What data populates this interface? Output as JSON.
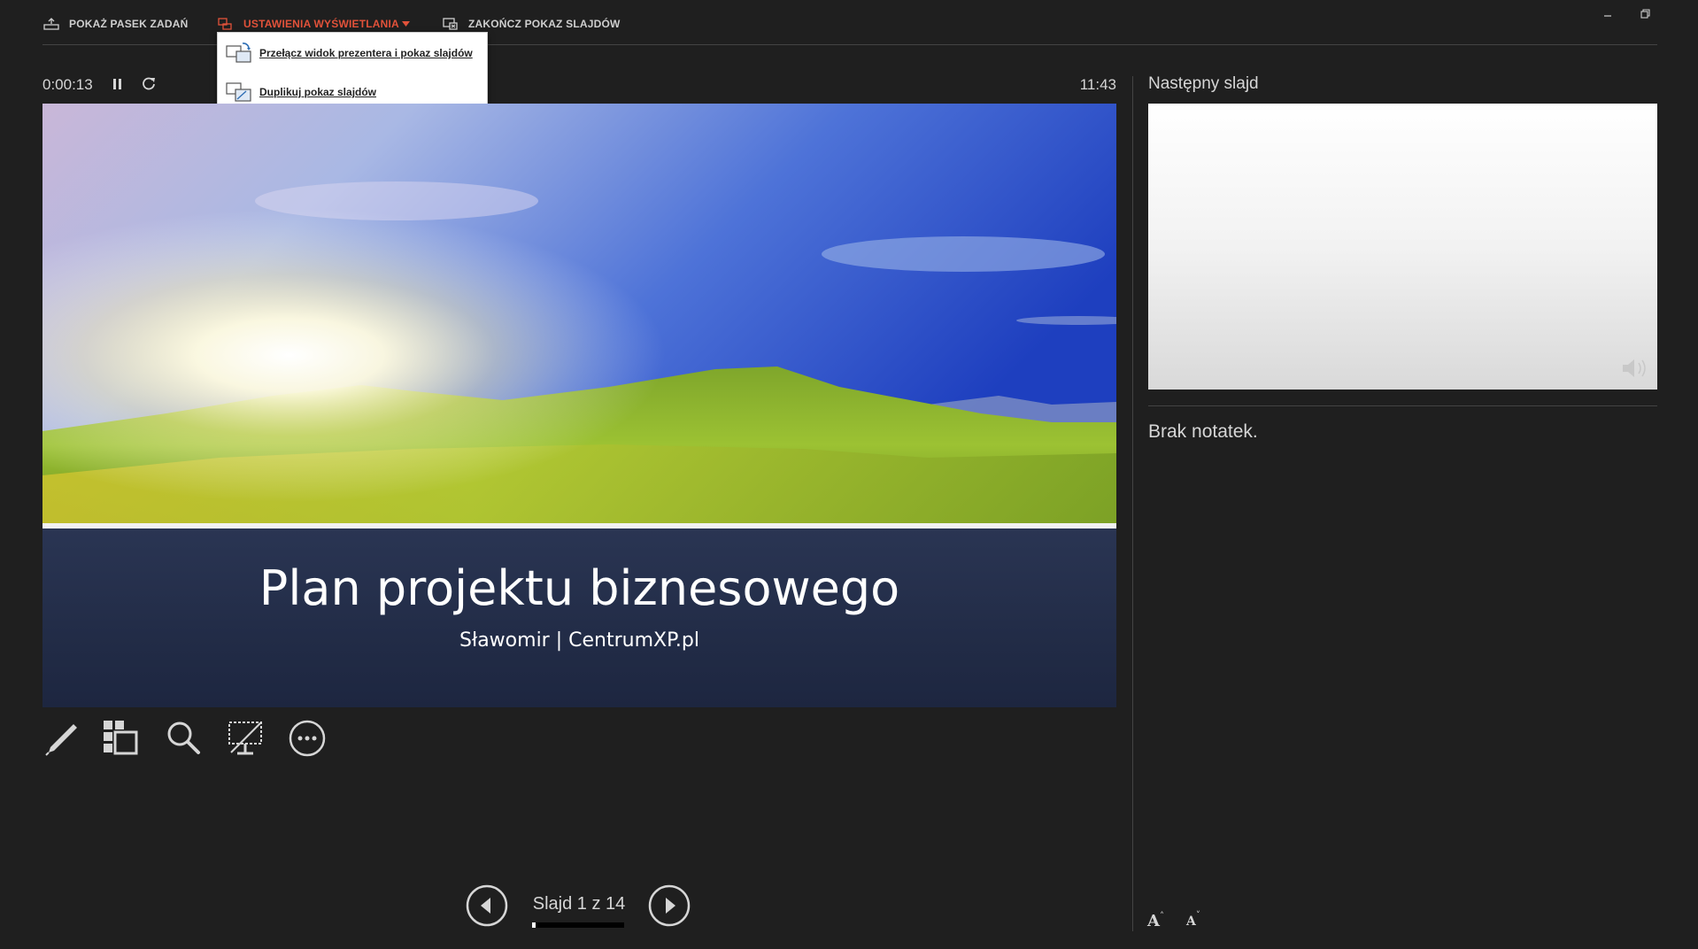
{
  "toolbar": {
    "show_taskbar": "POKAŻ PASEK ZADAŃ",
    "display_settings": "USTAWIENIA WYŚWIETLANIA",
    "end_show": "ZAKOŃCZ POKAZ SLAJDÓW",
    "display_settings_active_color": "#e2523a"
  },
  "window_controls": {
    "minimize_icon": "minimize-icon",
    "restore_icon": "restore-icon"
  },
  "dropdown": {
    "items": [
      {
        "label": "Przełącz widok prezentera i pokaz slajdów",
        "icon": "swap-presenter-icon"
      },
      {
        "label": "Duplikuj pokaz slajdów",
        "icon": "duplicate-display-icon"
      }
    ]
  },
  "timer": {
    "elapsed": "0:00:13",
    "clock": "11:43"
  },
  "slide": {
    "title": "Plan projektu biznesowego",
    "subtitle": "Sławomir | CentrumXP.pl",
    "band_color": "#222c47"
  },
  "tools": [
    "pen-icon",
    "see-all-slides-icon",
    "zoom-icon",
    "black-screen-icon",
    "more-options-icon"
  ],
  "navigation": {
    "counter": "Slajd 1 z 14",
    "current": 1,
    "total": 14
  },
  "next_slide": {
    "label": "Następny slajd"
  },
  "notes": {
    "text": "Brak notatek."
  },
  "font_controls": {
    "increase": "A",
    "decrease": "A"
  }
}
